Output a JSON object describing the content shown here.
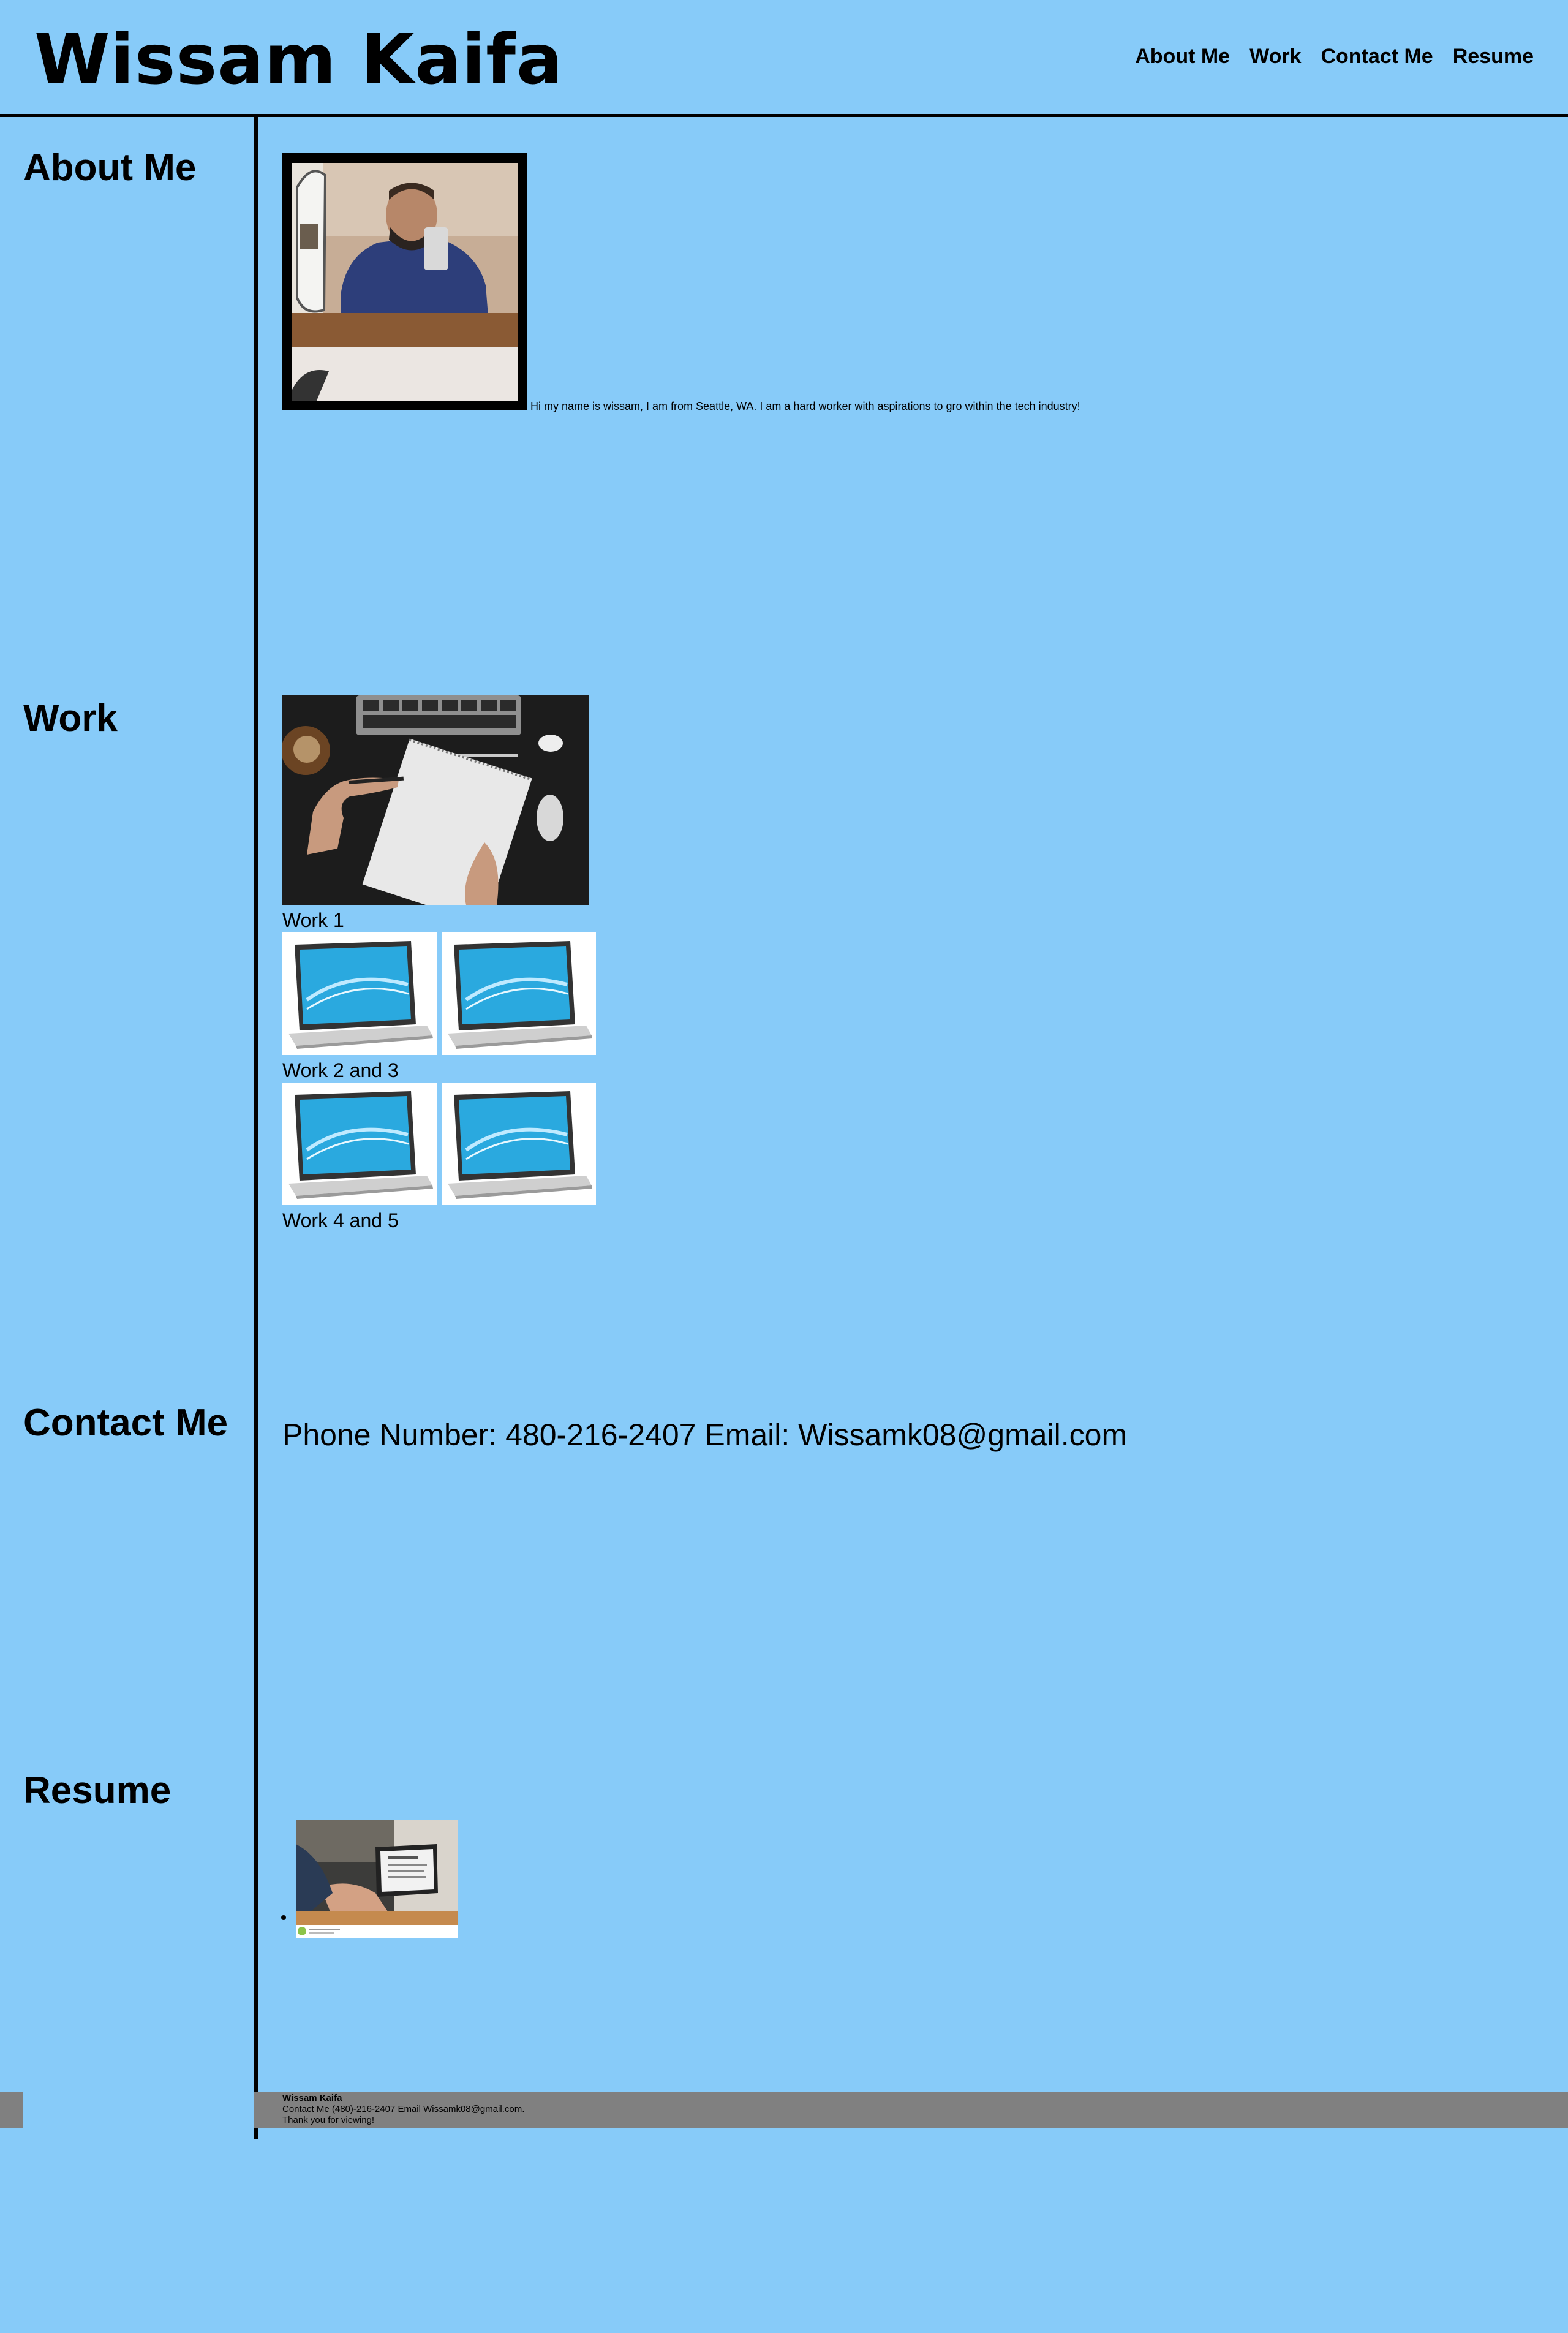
{
  "header": {
    "title": "Wissam Kaifa",
    "nav": [
      "About Me",
      "Work",
      "Contact Me",
      "Resume"
    ]
  },
  "sections": {
    "about": "About Me",
    "work": "Work",
    "contact": "Contact Me",
    "resume": "Resume"
  },
  "about": {
    "text": "Hi my name is wissam, I am from Seattle, WA. I am a hard worker with aspirations to gro within the tech industry!"
  },
  "work": {
    "caption1": "Work 1",
    "caption2": "Work 2 and 3",
    "caption3": "Work 4 and 5"
  },
  "contact": {
    "line": "Phone Number: 480-216-2407 Email: Wissamk08@gmail.com"
  },
  "footer": {
    "name": "Wissam Kaifa",
    "contact": "Contact Me (480)-216-2407 Email Wissamk08@gmail.com.",
    "thanks": "Thank you for viewing!"
  },
  "colors": {
    "background": "#87cbf9",
    "footer": "#808080",
    "border": "#000000"
  }
}
